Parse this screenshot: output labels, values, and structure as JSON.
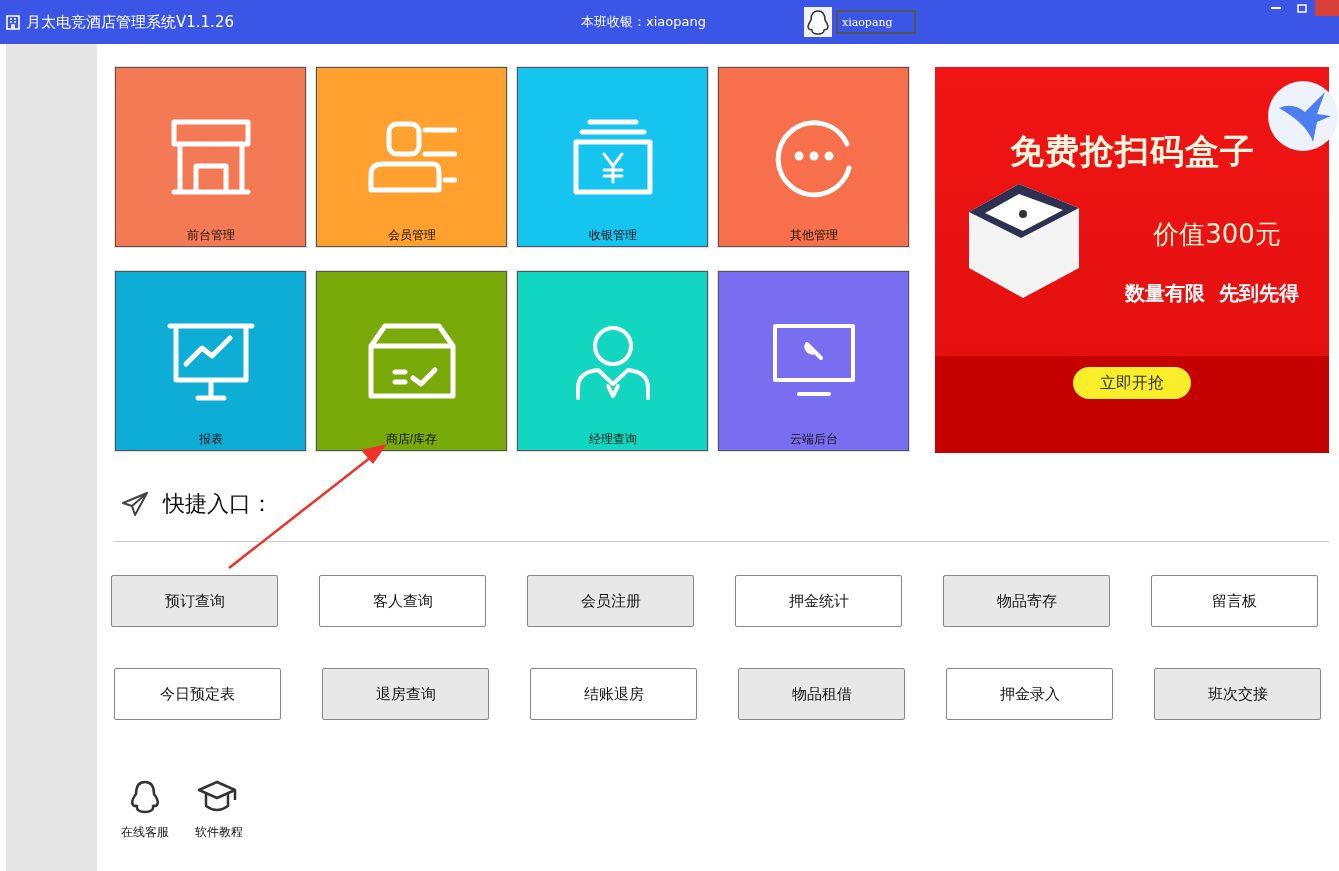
{
  "window": {
    "title": "月太电竞酒店管理系统V1.1.26",
    "cashier": "本班收银：xiaopang",
    "user": "xiaopang"
  },
  "tiles": [
    {
      "label": "前台管理",
      "kind": "store",
      "color": "#f47a56"
    },
    {
      "label": "会员管理",
      "kind": "member",
      "color": "#ffa02f"
    },
    {
      "label": "收银管理",
      "kind": "cash",
      "color": "#16c5ef"
    },
    {
      "label": "其他管理",
      "kind": "more",
      "color": "#f7704b"
    },
    {
      "label": "报表",
      "kind": "chart",
      "color": "#0eadd6"
    },
    {
      "label": "商店/库存",
      "kind": "box",
      "color": "#79aa0a"
    },
    {
      "label": "经理查询",
      "kind": "manager",
      "color": "#12d6bf"
    },
    {
      "label": "云端后台",
      "kind": "cloud",
      "color": "#7a6ef0"
    }
  ],
  "ad": {
    "headline": "免费抢扫码盒子",
    "price": "价值300元",
    "note": "数量有限  先到先得",
    "button": "立即开抢"
  },
  "shortcuts": {
    "title": "快捷入口：",
    "rows": [
      [
        {
          "label": "预订查询",
          "shaded": true
        },
        {
          "label": "客人查询",
          "shaded": false
        },
        {
          "label": "会员注册",
          "shaded": true
        },
        {
          "label": "押金统计",
          "shaded": false
        },
        {
          "label": "物品寄存",
          "shaded": true
        },
        {
          "label": "留言板",
          "shaded": false
        }
      ],
      [
        {
          "label": "今日预定表",
          "shaded": false
        },
        {
          "label": "退房查询",
          "shaded": true
        },
        {
          "label": "结账退房",
          "shaded": false
        },
        {
          "label": "物品租借",
          "shaded": true
        },
        {
          "label": "押金录入",
          "shaded": false
        },
        {
          "label": "班次交接",
          "shaded": true
        }
      ]
    ]
  },
  "help": [
    {
      "label": "在线客服",
      "kind": "penguin"
    },
    {
      "label": "软件教程",
      "kind": "cap"
    }
  ]
}
